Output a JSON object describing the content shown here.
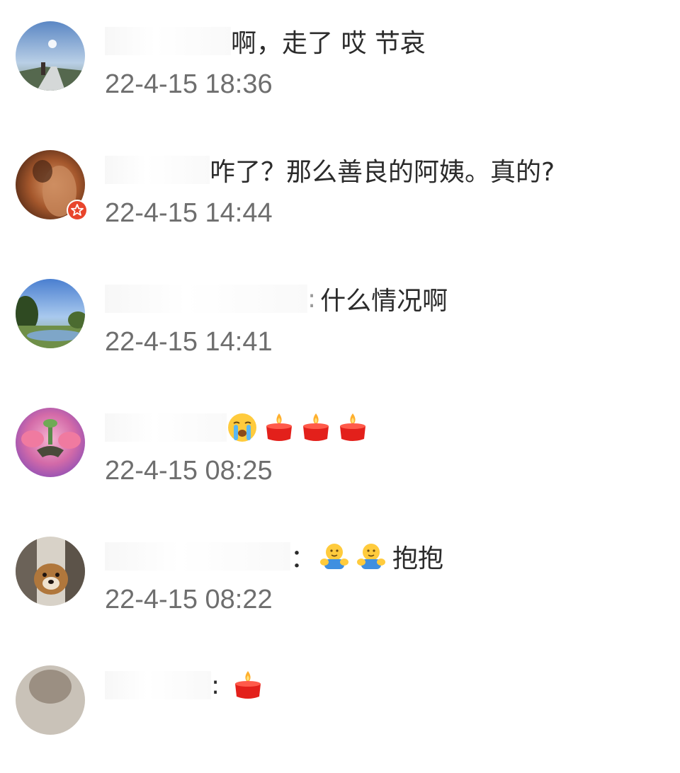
{
  "comments": [
    {
      "separator": "",
      "text": "啊，走了 哎 节哀",
      "time": "22-4-15 18:36",
      "emojis": []
    },
    {
      "separator": "",
      "text": "咋了？那么善良的阿姨。真的?",
      "time": "22-4-15 14:44",
      "emojis": []
    },
    {
      "separator": ":",
      "text": "什么情况啊",
      "time": "22-4-15 14:41",
      "emojis": []
    },
    {
      "separator": "",
      "text": "",
      "time": "22-4-15 08:25",
      "emojis": [
        "crying-face-icon",
        "candle-icon",
        "candle-icon",
        "candle-icon"
      ]
    },
    {
      "separator": "：",
      "text": "抱抱",
      "time": "22-4-15 08:22",
      "emojis": [
        "hug-icon",
        "hug-icon"
      ]
    },
    {
      "separator": ":",
      "text": "",
      "time": "",
      "emojis": [
        "candle-icon"
      ]
    }
  ],
  "colors": {
    "text": "#2b2b2b",
    "time": "#6e6e6e",
    "badge": "#e8452c"
  }
}
